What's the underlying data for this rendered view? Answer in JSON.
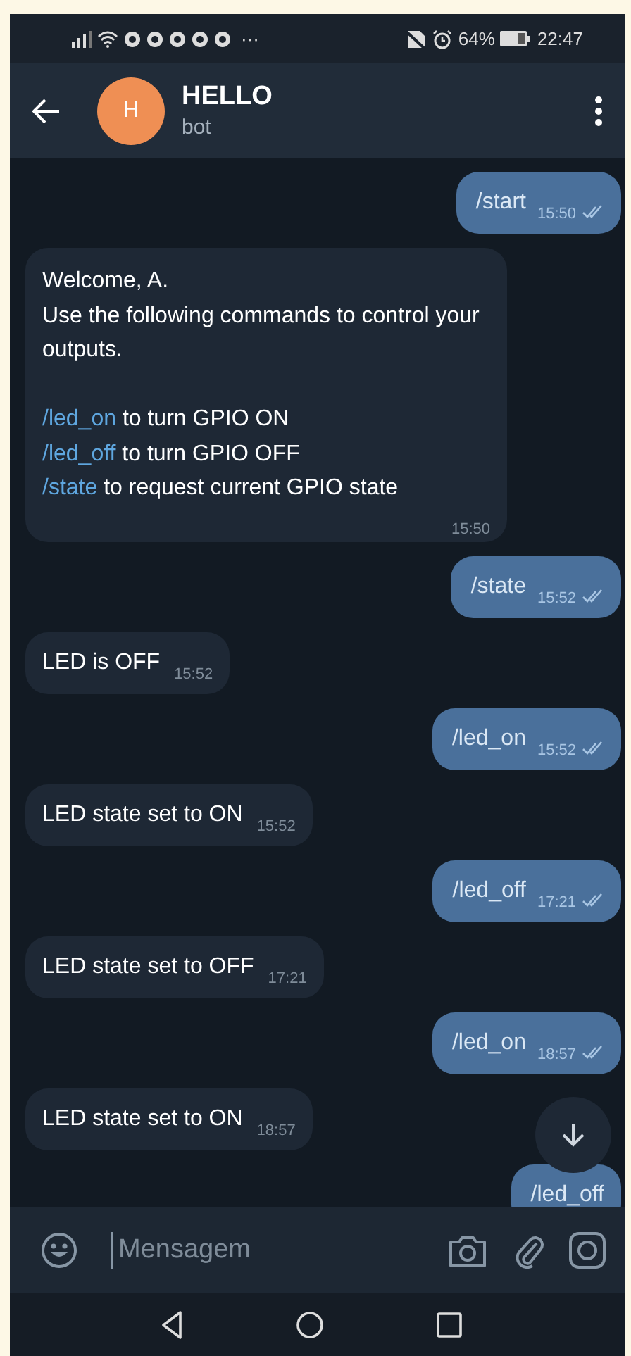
{
  "status_bar": {
    "more": "···",
    "battery": "64%",
    "time": "22:47"
  },
  "header": {
    "avatar_letter": "H",
    "title": "HELLO",
    "subtitle": "bot"
  },
  "messages": [
    {
      "kind": "out",
      "text": "/start",
      "time": "15:50",
      "read": true
    },
    {
      "kind": "in",
      "lines": [
        {
          "kind": "text",
          "text": "Welcome, A."
        },
        {
          "kind": "text",
          "text": "Use the following commands to control your outputs."
        },
        {
          "kind": "gap"
        },
        {
          "kind": "command",
          "command": "/led_on",
          "text": " to turn GPIO ON"
        },
        {
          "kind": "command",
          "command": "/led_off",
          "text": " to turn GPIO OFF"
        },
        {
          "kind": "command",
          "command": "/state",
          "text": " to request current GPIO state"
        }
      ],
      "time": "15:50"
    },
    {
      "kind": "out",
      "text": "/state",
      "time": "15:52",
      "read": true
    },
    {
      "kind": "in",
      "text": "LED is OFF",
      "time": "15:52"
    },
    {
      "kind": "out",
      "text": "/led_on",
      "time": "15:52",
      "read": true
    },
    {
      "kind": "in",
      "text": "LED state set to ON",
      "time": "15:52"
    },
    {
      "kind": "out",
      "text": "/led_off",
      "time": "17:21",
      "read": true
    },
    {
      "kind": "in",
      "text": "LED state set to OFF",
      "time": "17:21"
    },
    {
      "kind": "out",
      "text": "/led_on",
      "time": "18:57",
      "read": true
    },
    {
      "kind": "in",
      "text": "LED state set to ON",
      "time": "18:57"
    },
    {
      "kind": "out",
      "text": "/led_off"
    }
  ],
  "composer": {
    "placeholder": "Mensagem"
  }
}
